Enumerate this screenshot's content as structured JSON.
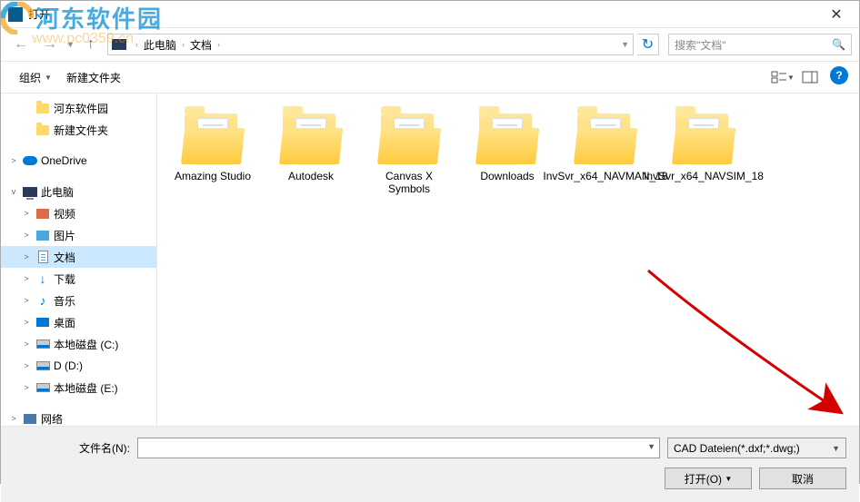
{
  "window": {
    "title": "打开"
  },
  "breadcrumb": {
    "root": "此电脑",
    "current": "文档"
  },
  "search": {
    "placeholder": "搜索\"文档\""
  },
  "toolbar": {
    "organize": "组织",
    "new_folder": "新建文件夹"
  },
  "sidebar": {
    "items": [
      {
        "label": "河东软件园",
        "type": "folder",
        "indent": 1
      },
      {
        "label": "新建文件夹",
        "type": "folder",
        "indent": 1
      },
      {
        "label": "OneDrive",
        "type": "onedrive",
        "exp": ">",
        "indent": 0
      },
      {
        "label": "此电脑",
        "type": "pc",
        "exp": "v",
        "indent": 0
      },
      {
        "label": "视频",
        "type": "video",
        "exp": ">",
        "indent": 1
      },
      {
        "label": "图片",
        "type": "pic",
        "exp": ">",
        "indent": 1
      },
      {
        "label": "文档",
        "type": "doc",
        "exp": ">",
        "indent": 1,
        "selected": true
      },
      {
        "label": "下载",
        "type": "dl",
        "exp": ">",
        "indent": 1
      },
      {
        "label": "音乐",
        "type": "music",
        "exp": ">",
        "indent": 1
      },
      {
        "label": "桌面",
        "type": "desk",
        "exp": ">",
        "indent": 1
      },
      {
        "label": "本地磁盘 (C:)",
        "type": "disk",
        "exp": ">",
        "indent": 1
      },
      {
        "label": "D (D:)",
        "type": "disk",
        "exp": ">",
        "indent": 1
      },
      {
        "label": "本地磁盘 (E:)",
        "type": "disk",
        "exp": ">",
        "indent": 1
      },
      {
        "label": "网络",
        "type": "net",
        "exp": ">",
        "indent": 0
      }
    ]
  },
  "folders": [
    {
      "name": "Amazing Studio"
    },
    {
      "name": "Autodesk"
    },
    {
      "name": "Canvas X Symbols"
    },
    {
      "name": "Downloads"
    },
    {
      "name": "InvSvr_x64_NAVMAN_18"
    },
    {
      "name": "InvSvr_x64_NAVSIM_18"
    }
  ],
  "footer": {
    "filename_label": "文件名(N):",
    "filter": "CAD Dateien(*.dxf;*.dwg;)",
    "open": "打开(O)",
    "cancel": "取消"
  },
  "watermark": {
    "brand": "河东软件园",
    "url": "www.pc0359.cn"
  }
}
